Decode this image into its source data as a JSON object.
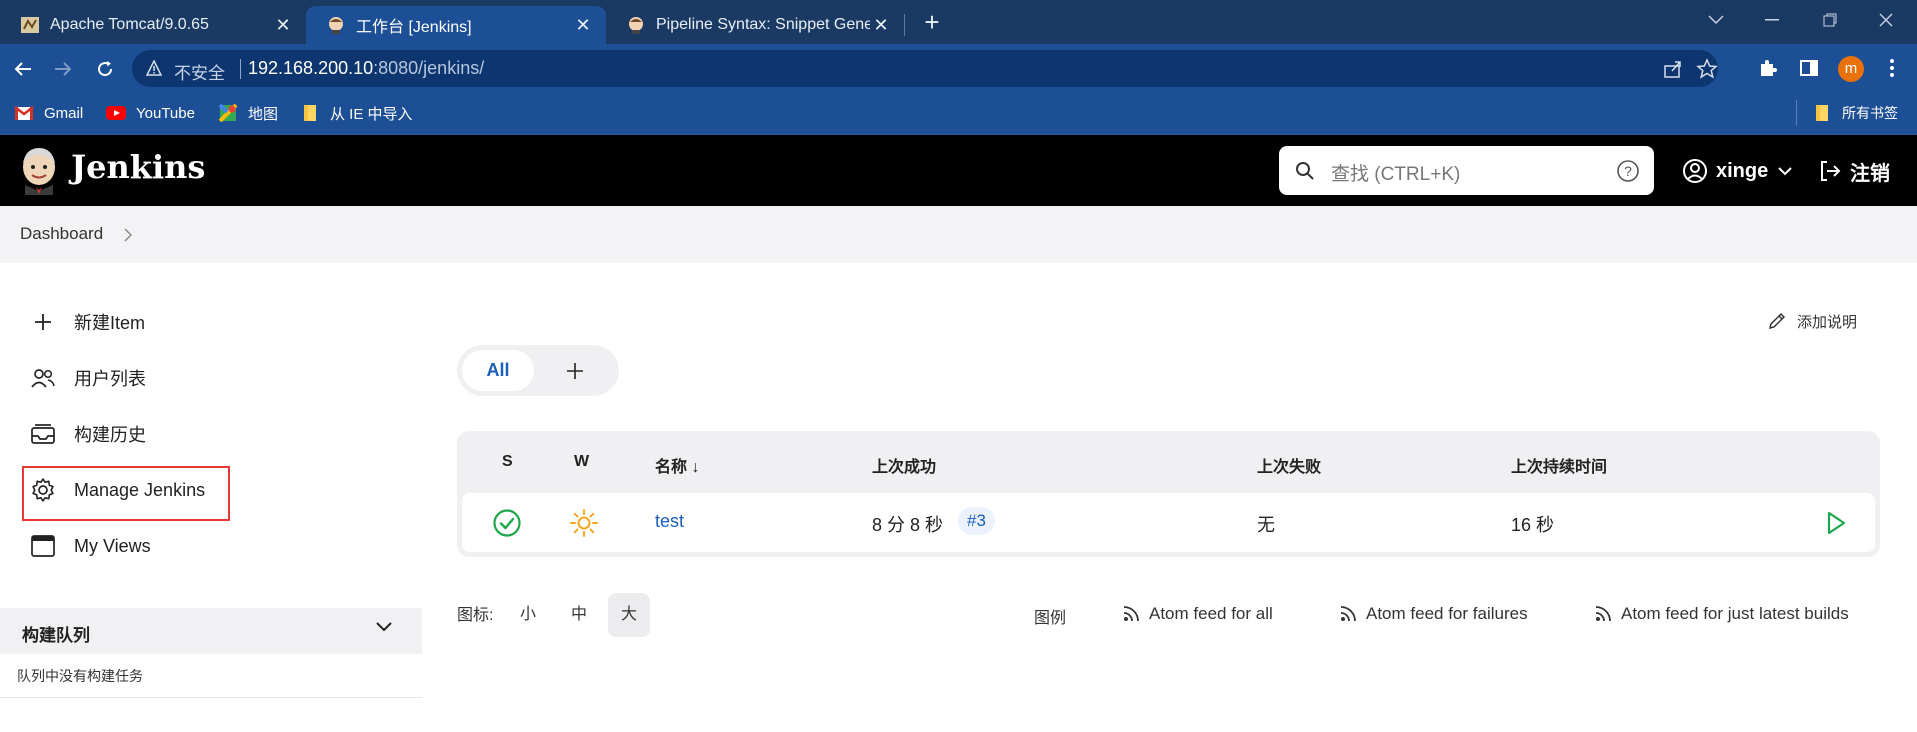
{
  "browser": {
    "tabs": [
      {
        "title": "Apache Tomcat/9.0.65",
        "active": false
      },
      {
        "title": "工作台 [Jenkins]",
        "active": true
      },
      {
        "title": "Pipeline Syntax: Snippet Generator",
        "active": false
      }
    ],
    "address": {
      "security_label": "不安全",
      "host": "192.168.200.10",
      "rest": ":8080/jenkins/"
    },
    "profile_initial": "m",
    "bookmarks": [
      {
        "label": "Gmail",
        "icon": "gmail-icon"
      },
      {
        "label": "YouTube",
        "icon": "youtube-icon"
      },
      {
        "label": "地图",
        "icon": "maps-icon"
      },
      {
        "label": "从 IE 中导入",
        "icon": "folder-icon"
      }
    ],
    "all_bookmarks_label": "所有书签"
  },
  "jenkins": {
    "app_title": "Jenkins",
    "search_placeholder": "查找 (CTRL+K)",
    "user_name": "xinge",
    "logout_label": "注销",
    "breadcrumb": [
      "Dashboard"
    ],
    "side_menu": [
      {
        "label": "新建Item",
        "icon": "plus-icon"
      },
      {
        "label": "用户列表",
        "icon": "people-icon"
      },
      {
        "label": "构建历史",
        "icon": "inbox-icon"
      },
      {
        "label": "Manage Jenkins",
        "icon": "gear-icon"
      },
      {
        "label": "My Views",
        "icon": "window-icon"
      }
    ],
    "build_queue": {
      "title": "构建队列",
      "empty_text": "队列中没有构建任务"
    },
    "add_description_label": "添加说明",
    "view_tabs": {
      "active": "All",
      "add": "+"
    },
    "table": {
      "headers": [
        "S",
        "W",
        "名称 ↓",
        "上次成功",
        "上次失败",
        "上次持续时间"
      ],
      "rows": [
        {
          "name": "test",
          "last_success": "8 分 8 秒",
          "build": "#3",
          "last_failure": "无",
          "last_duration": "16 秒",
          "status": "success",
          "weather": "sunny"
        }
      ]
    },
    "icon_size_label": "图标:",
    "icon_sizes": [
      "小",
      "中",
      "大"
    ],
    "selected_icon_size": "大",
    "legend_label": "图例",
    "feeds": [
      "Atom feed for all",
      "Atom feed for failures",
      "Atom feed for just latest builds"
    ]
  },
  "colors": {
    "tab_strip": "#1a3a63",
    "toolbar": "#1c4f95",
    "jenkins_header": "#000000",
    "link_blue": "#1a5eba",
    "success_green": "#1ea64b",
    "weather_sun": "#f5a623",
    "highlight_red": "#e53935"
  }
}
